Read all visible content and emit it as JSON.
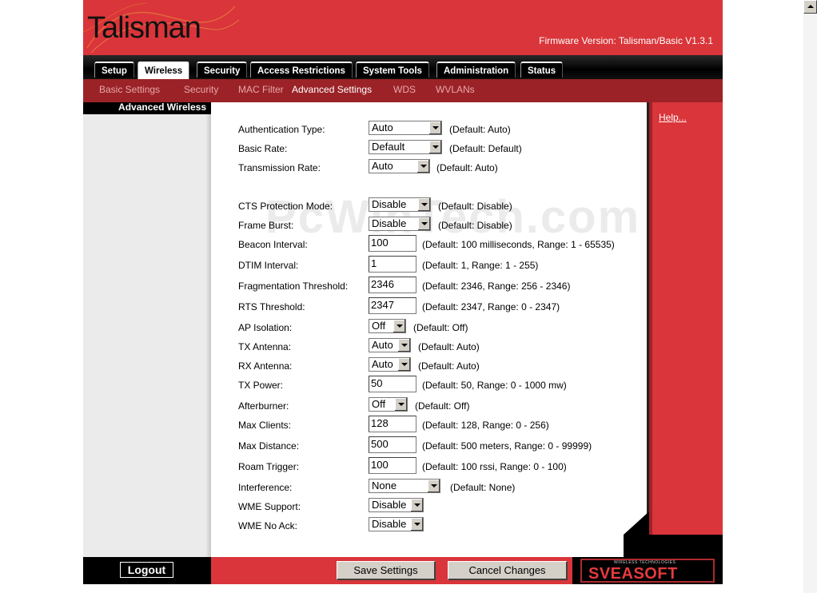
{
  "header": {
    "logo_text": "Talisman",
    "firmware": "Firmware Version: Talisman/Basic V1.3.1"
  },
  "tabs": [
    {
      "label": "Setup"
    },
    {
      "label": "Wireless",
      "active": true
    },
    {
      "label": "Security"
    },
    {
      "label": "Access Restrictions"
    },
    {
      "label": "System Tools"
    },
    {
      "label": "Administration"
    },
    {
      "label": "Status"
    }
  ],
  "submenu": [
    {
      "label": "Basic Settings"
    },
    {
      "label": "Security"
    },
    {
      "label": "MAC Filter"
    },
    {
      "label": "Advanced Settings",
      "active": true
    },
    {
      "label": "WDS"
    },
    {
      "label": "WVLANs"
    }
  ],
  "sidebar": {
    "title": "Advanced Wireless"
  },
  "help_link": "Help...",
  "watermark": "PcWinTech.com",
  "fields": [
    {
      "label": "Authentication Type:",
      "kind": "select",
      "value": "Auto",
      "default": "(Default: Auto)"
    },
    {
      "label": "Basic Rate:",
      "kind": "select",
      "value": "Default",
      "default": "(Default: Default)"
    },
    {
      "label": "Transmission Rate:",
      "kind": "select",
      "value": "Auto",
      "default": "(Default: Auto)"
    },
    {
      "label": "CTS Protection Mode:",
      "kind": "select",
      "value": "Disable",
      "default": "(Default: Disable)"
    },
    {
      "label": "Frame Burst:",
      "kind": "select",
      "value": "Disable",
      "default": "(Default: Disable)"
    },
    {
      "label": "Beacon Interval:",
      "kind": "text",
      "value": "100",
      "default": "(Default: 100 milliseconds, Range: 1 - 65535)"
    },
    {
      "label": "DTIM Interval:",
      "kind": "text",
      "value": "1",
      "default": "(Default: 1, Range: 1 - 255)"
    },
    {
      "label": "Fragmentation Threshold:",
      "kind": "text",
      "value": "2346",
      "default": "(Default: 2346, Range: 256 - 2346)"
    },
    {
      "label": "RTS Threshold:",
      "kind": "text",
      "value": "2347",
      "default": "(Default: 2347, Range: 0 - 2347)"
    },
    {
      "label": "AP Isolation:",
      "kind": "select",
      "value": "Off",
      "default": "(Default: Off)"
    },
    {
      "label": "TX Antenna:",
      "kind": "select",
      "value": "Auto",
      "default": "(Default: Auto)"
    },
    {
      "label": "RX Antenna:",
      "kind": "select",
      "value": "Auto",
      "default": "(Default: Auto)"
    },
    {
      "label": "TX Power:",
      "kind": "text",
      "value": "50",
      "default": "(Default: 50, Range: 0 - 1000 mw)"
    },
    {
      "label": "Afterburner:",
      "kind": "select",
      "value": "Off",
      "default": "(Default: Off)"
    },
    {
      "label": "Max Clients:",
      "kind": "text",
      "value": "128",
      "default": "(Default: 128, Range: 0 - 256)"
    },
    {
      "label": "Max Distance:",
      "kind": "text",
      "value": "500",
      "default": "(Default: 500 meters, Range: 0 - 99999)"
    },
    {
      "label": "Roam Trigger:",
      "kind": "text",
      "value": "100",
      "default": "(Default: 100 rssi, Range: 0 - 100)"
    },
    {
      "label": "Interference:",
      "kind": "select",
      "value": "None",
      "default": "(Default: None)"
    },
    {
      "label": "WME Support:",
      "kind": "select",
      "value": "Disable",
      "default": ""
    },
    {
      "label": "WME No Ack:",
      "kind": "select",
      "value": "Disable",
      "default": ""
    }
  ],
  "footer": {
    "logout": "Logout",
    "save": "Save Settings",
    "cancel": "Cancel Changes",
    "brand": "SVEASOFT",
    "brand_small": "WIRELESS TECHNOLOGIES"
  }
}
